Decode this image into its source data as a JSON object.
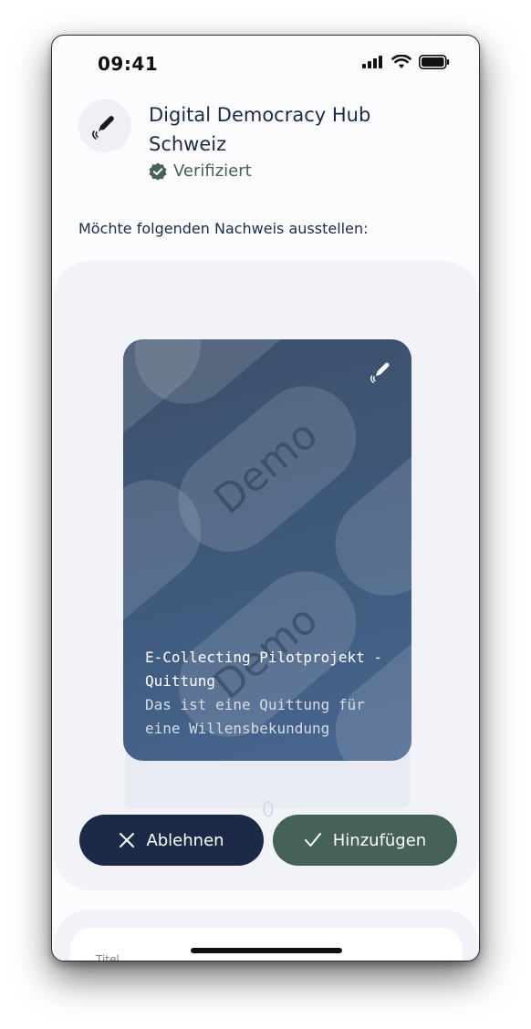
{
  "status_bar": {
    "time": "09:41"
  },
  "issuer": {
    "name": "Digital Democracy Hub Schweiz",
    "verified_label": "Verifiziert",
    "logo_icon": "pen-icon"
  },
  "prompt_text": "Möchte folgenden Nachweis ausstellen:",
  "credential_card": {
    "watermark": "Demo",
    "title": "E-Collecting Pilotprojekt - Quittung",
    "description": "Das ist eine Quittung für eine Willensbekundung",
    "icon": "pen-icon"
  },
  "actions": {
    "decline_label": "Ablehnen",
    "accept_label": "Hinzufügen"
  },
  "details": {
    "first_label": "Titel"
  },
  "colors": {
    "navy": "#1c2a47",
    "green": "#466157",
    "card_blue": "#3f5a7d",
    "panel": "#f1f3f9"
  }
}
